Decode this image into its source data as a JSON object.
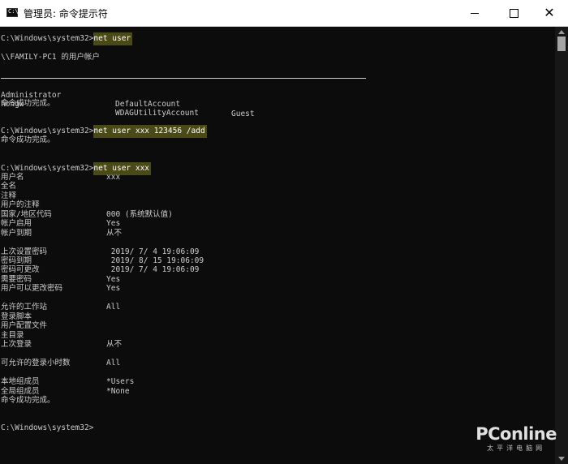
{
  "window": {
    "icon_label": "C:\\",
    "title": "管理员: 命令提示符",
    "controls": [
      "minimize",
      "maximize",
      "close"
    ]
  },
  "console": {
    "cmd1": {
      "prompt": "C:\\Windows\\system32>",
      "command": "net user"
    },
    "user_accounts_header": "\\\\FAMILY-PC1 的用户帐户",
    "accounts": [
      [
        "Administrator",
        "DefaultAccount",
        "Guest"
      ],
      [
        "hongw",
        "WDAGUtilityAccount",
        ""
      ]
    ],
    "success1": "命令成功完成。",
    "cmd2": {
      "prompt": "C:\\Windows\\system32>",
      "command": "net user xxx 123456 /add"
    },
    "success2": "命令成功完成。",
    "cmd3": {
      "prompt": "C:\\Windows\\system32>",
      "command": "net user xxx"
    },
    "details": [
      {
        "label": "用户名",
        "value": "xxx"
      },
      {
        "label": "全名",
        "value": ""
      },
      {
        "label": "注释",
        "value": ""
      },
      {
        "label": "用户的注释",
        "value": ""
      },
      {
        "label": "国家/地区代码",
        "value": "000 (系统默认值)"
      },
      {
        "label": "帐户启用",
        "value": "Yes"
      },
      {
        "label": "帐户到期",
        "value": "从不"
      },
      {
        "label": "上次设置密码",
        "value": " 2019/ 7/ 4 19:06:09"
      },
      {
        "label": "密码到期",
        "value": " 2019/ 8/ 15 19:06:09"
      },
      {
        "label": "密码可更改",
        "value": " 2019/ 7/ 4 19:06:09"
      },
      {
        "label": "需要密码",
        "value": "Yes"
      },
      {
        "label": "用户可以更改密码",
        "value": "Yes"
      },
      {
        "label": "允许的工作站",
        "value": "All"
      },
      {
        "label": "登录脚本",
        "value": ""
      },
      {
        "label": "用户配置文件",
        "value": ""
      },
      {
        "label": "主目录",
        "value": ""
      },
      {
        "label": "上次登录",
        "value": "从不"
      },
      {
        "label": "可允许的登录小时数",
        "value": "All"
      },
      {
        "label": "本地组成员",
        "value": "*Users"
      },
      {
        "label": "全局组成员",
        "value": "*None"
      }
    ],
    "success3": "命令成功完成。",
    "final_prompt": "C:\\Windows\\system32>"
  },
  "watermark": {
    "brand": "PConline",
    "tagline": "太平洋电脑网"
  },
  "colors": {
    "background": "#0c0c0c",
    "text": "#cccccc",
    "highlight": "#4a4a18"
  }
}
